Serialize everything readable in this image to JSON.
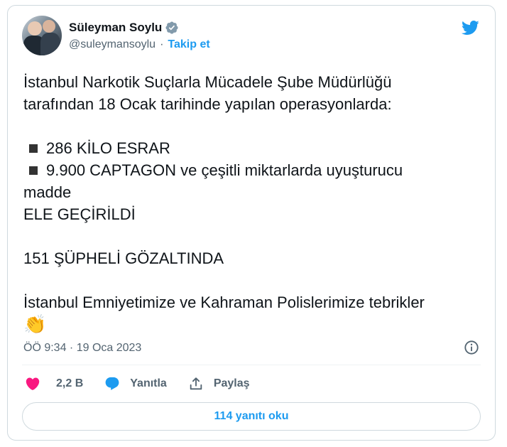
{
  "author": {
    "display_name": "Süleyman Soylu",
    "handle": "@suleymansoylu",
    "separator": "·",
    "follow_label": "Takip et"
  },
  "tweet": {
    "lines": [
      "İstanbul Narkotik Suçlarla Mücadele Şube Müdürlüğü",
      "tarafından 18 Ocak tarihinde yapılan operasyonlarda:"
    ],
    "bullets": [
      "286 KİLO ESRAR",
      "9.900 CAPTAGON ve çeşitli miktarlarda uyuşturucu"
    ],
    "continuation": [
      "madde",
      "ELE GEÇİRİLDİ"
    ],
    "suspects": "151 ŞÜPHELİ GÖZALTINDA",
    "closing": "İstanbul Emniyetimize ve Kahraman Polislerimize tebrikler",
    "emoji": "👏"
  },
  "meta": {
    "timestamp": "ÖÖ 9:34 · 19 Oca 2023"
  },
  "actions": {
    "like_count": "2,2 B",
    "reply_label": "Yanıtla",
    "share_label": "Paylaş"
  },
  "replies_button": "114 yanıtı oku",
  "colors": {
    "accent": "#1d9bf0",
    "like": "#f91880",
    "text": "#0f1419",
    "secondary": "#536471",
    "border": "#cfd9de"
  },
  "icons": [
    "verified-badge-icon",
    "twitter-bird-icon",
    "info-icon",
    "heart-icon",
    "reply-bubble-icon",
    "share-icon",
    "bullet-square-icon"
  ]
}
